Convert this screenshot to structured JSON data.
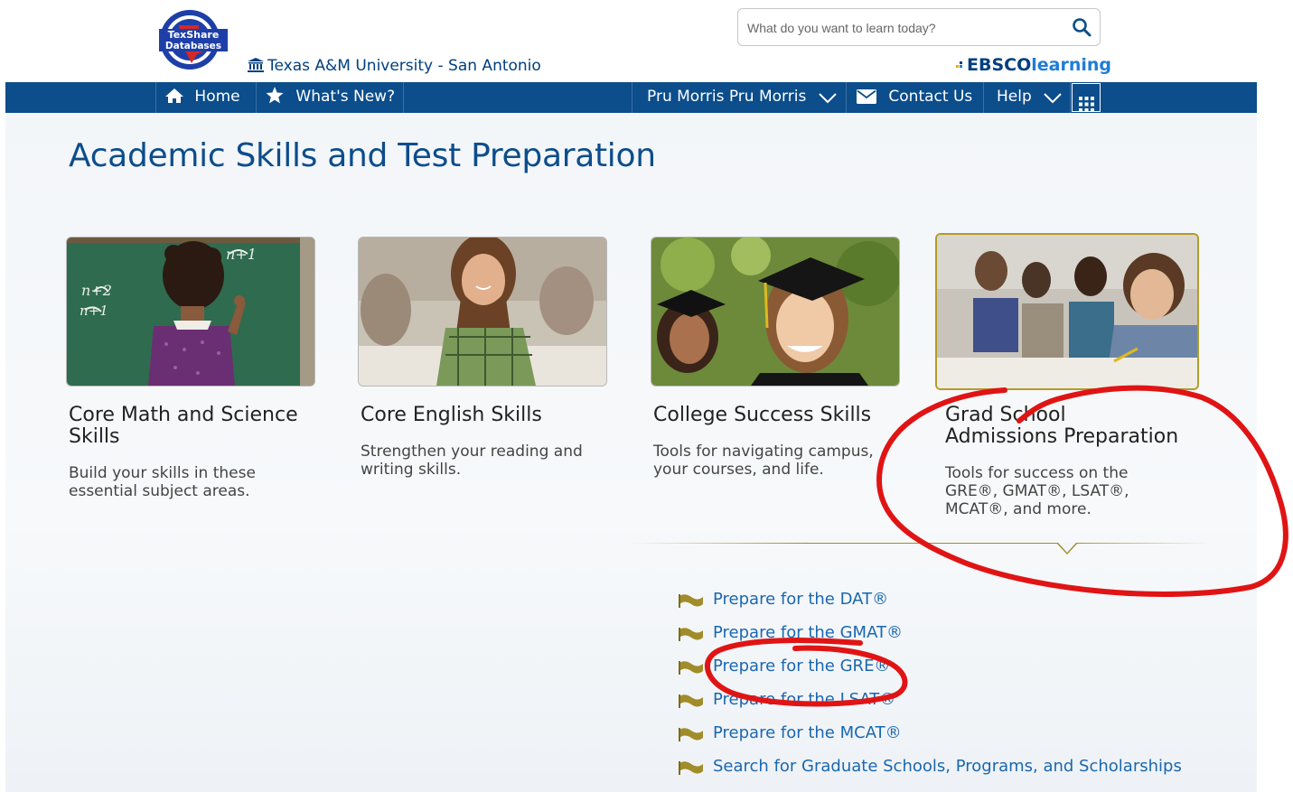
{
  "logo": {
    "line1": "TexShare",
    "line2": "Databases"
  },
  "header": {
    "institution": "Texas A&M University - San Antonio",
    "search_placeholder": "What do you want to learn today?",
    "brand_primary": "EBSCO",
    "brand_secondary": "learning"
  },
  "nav": {
    "home": "Home",
    "whats_new": "What's New?",
    "user": "Pru Morris Pru Morris",
    "contact": "Contact Us",
    "help": "Help"
  },
  "page_title": "Academic Skills and Test Preparation",
  "cards": [
    {
      "title": "Core Math and Science Skills",
      "description": "Build your skills in these essential subject areas."
    },
    {
      "title": "Core English Skills",
      "description": "Strengthen your reading and writing skills."
    },
    {
      "title": "College Success Skills",
      "description": "Tools for navigating campus, your courses, and life."
    },
    {
      "title": "Grad School Admissions Preparation",
      "description": "Tools for success on the GRE®, GMAT®, LSAT®, MCAT®, and more."
    }
  ],
  "links": [
    "Prepare for the DAT®",
    "Prepare for the GMAT®",
    "Prepare for the GRE®",
    "Prepare for the LSAT®",
    "Prepare for the MCAT®",
    "Search for Graduate Schools, Programs, and Scholarships"
  ],
  "colors": {
    "nav_bg": "#0c4d8c",
    "title_blue": "#0c4d8c",
    "link_blue": "#1a67b0",
    "flag_gold": "#a18c2a",
    "annotation_red": "#e01414"
  }
}
